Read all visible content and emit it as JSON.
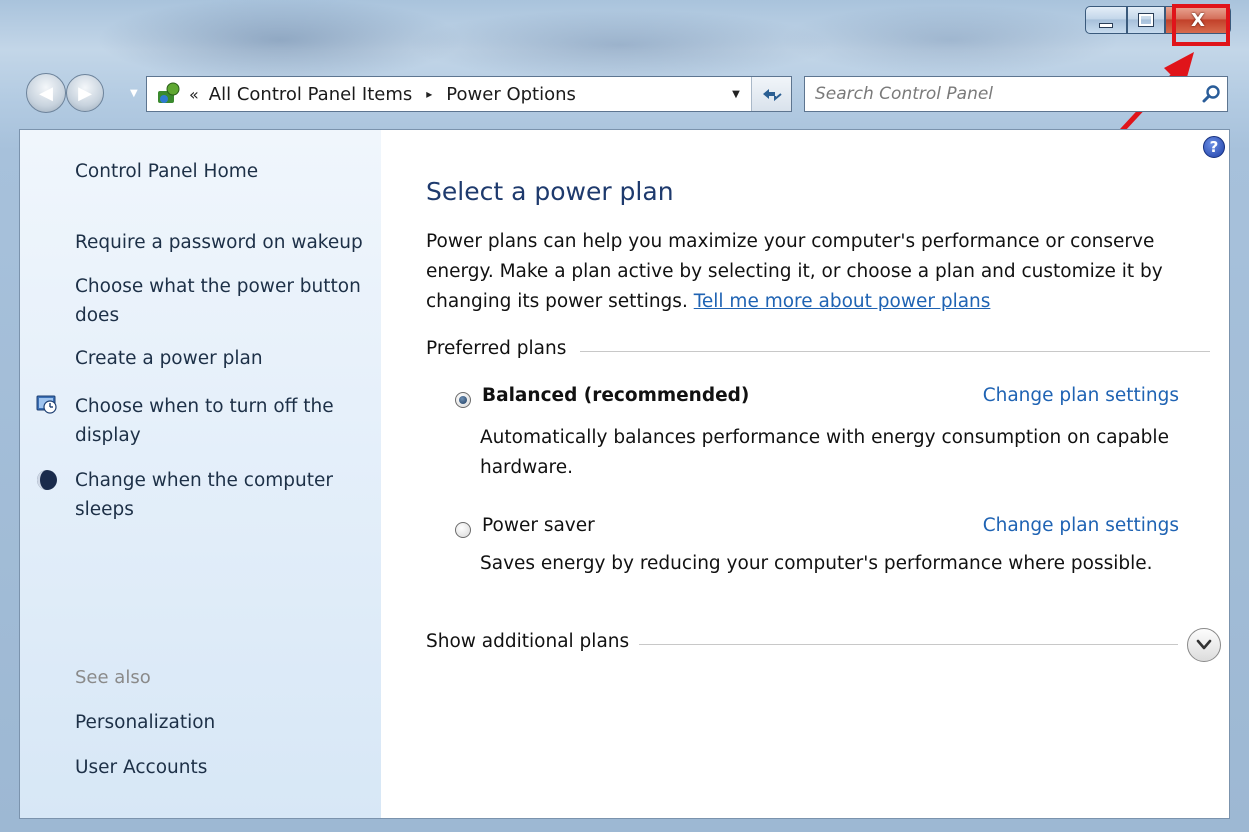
{
  "window": {
    "minimize_icon": "minimize-icon",
    "maximize_icon": "maximize-icon",
    "close_icon": "close-icon",
    "close_label": "X",
    "highlight_color": "#e0141a"
  },
  "navigation": {
    "back_icon": "back-arrow-icon",
    "forward_icon": "forward-arrow-icon",
    "history_icon": "chevron-down-icon"
  },
  "address_bar": {
    "chevron": "«",
    "crumbs": [
      "All Control Panel Items",
      "Power Options"
    ],
    "separator": "▸",
    "dropdown": "▼",
    "refresh_icon": "refresh-icon"
  },
  "search": {
    "placeholder": "Search Control Panel",
    "icon": "search-icon"
  },
  "sidebar": {
    "home": "Control Panel Home",
    "links": [
      "Require a password on wakeup",
      "Choose what the power button does",
      "Create a power plan",
      "Choose when to turn off the display",
      "Change when the computer sleeps"
    ],
    "see_also_label": "See also",
    "see_also": [
      "Personalization",
      "User Accounts"
    ]
  },
  "main": {
    "help": "?",
    "title": "Select a power plan",
    "intro": "Power plans can help you maximize your computer's performance or conserve energy. Make a plan active by selecting it, or choose a plan and customize it by changing its power settings.",
    "intro_link": "Tell me more about power plans",
    "preferred_label": "Preferred plans",
    "plans": [
      {
        "name": "Balanced (recommended)",
        "selected": true,
        "desc": "Automatically balances performance with energy consumption on capable hardware.",
        "link": "Change plan settings"
      },
      {
        "name": "Power saver",
        "selected": false,
        "desc": "Saves energy by reducing your computer's performance where possible.",
        "link": "Change plan settings"
      }
    ],
    "additional_label": "Show additional plans"
  }
}
